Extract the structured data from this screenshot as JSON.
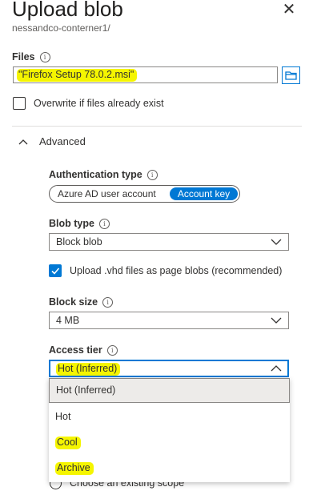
{
  "panel": {
    "title": "Upload blob",
    "subtitle": "nessandco-conterner1/"
  },
  "files": {
    "label": "Files",
    "value": "\"Firefox Setup 78.0.2.msi\"",
    "browse_icon": "folder-icon"
  },
  "overwrite": {
    "label": "Overwrite if files already exist",
    "checked": false
  },
  "advanced": {
    "label": "Advanced",
    "expanded": true
  },
  "auth": {
    "label": "Authentication type",
    "options": [
      "Azure AD user account",
      "Account key"
    ],
    "selected": "Account key"
  },
  "blob_type": {
    "label": "Blob type",
    "value": "Block blob"
  },
  "vhd": {
    "label": "Upload .vhd files as page blobs (recommended)",
    "checked": true
  },
  "block_size": {
    "label": "Block size",
    "value": "4 MB"
  },
  "access_tier": {
    "label": "Access tier",
    "value": "Hot (Inferred)",
    "options": [
      "Hot (Inferred)",
      "Hot",
      "Cool",
      "Archive"
    ],
    "selected_option": "Hot (Inferred)"
  },
  "scope": {
    "label": "Choose an existing scope"
  },
  "colors": {
    "accent": "#0078d4",
    "highlight": "#f5f500",
    "text": "#323130"
  }
}
